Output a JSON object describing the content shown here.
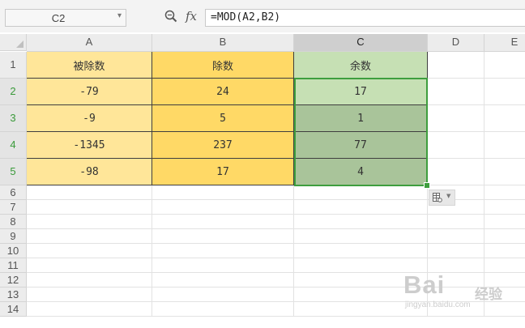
{
  "name_box": {
    "value": "C2"
  },
  "formula_bar": {
    "fx_label": "fx",
    "formula": "=MOD(A2,B2)"
  },
  "columns": [
    "A",
    "B",
    "C",
    "D",
    "E"
  ],
  "selected_column": "C",
  "rows": [
    "1",
    "2",
    "3",
    "4",
    "5",
    "6",
    "7",
    "8",
    "9",
    "10",
    "11",
    "12",
    "13",
    "14"
  ],
  "selected_rows": [
    "2",
    "3",
    "4",
    "5"
  ],
  "headers": [
    "被除数",
    "除数",
    "余数"
  ],
  "data": [
    [
      "-79",
      "24",
      "17"
    ],
    [
      "-9",
      "5",
      "1"
    ],
    [
      "-1345",
      "237",
      "77"
    ],
    [
      "-98",
      "17",
      "4"
    ]
  ],
  "colors": {
    "col_a_fill": "#ffe699",
    "col_b_fill": "#ffd966",
    "col_c_header_fill": "#c6e0b4",
    "active_cell_fill": "#c6e0b4",
    "selected_fill": "#a9c49a",
    "selection_border": "#3e9e3e"
  },
  "icons": {
    "zoom": "zoom-icon",
    "quick_analysis": "quick-analysis-icon"
  },
  "watermark": {
    "brand": "Bai",
    "suffix": "经验",
    "url": "jingyan.baidu.com"
  }
}
